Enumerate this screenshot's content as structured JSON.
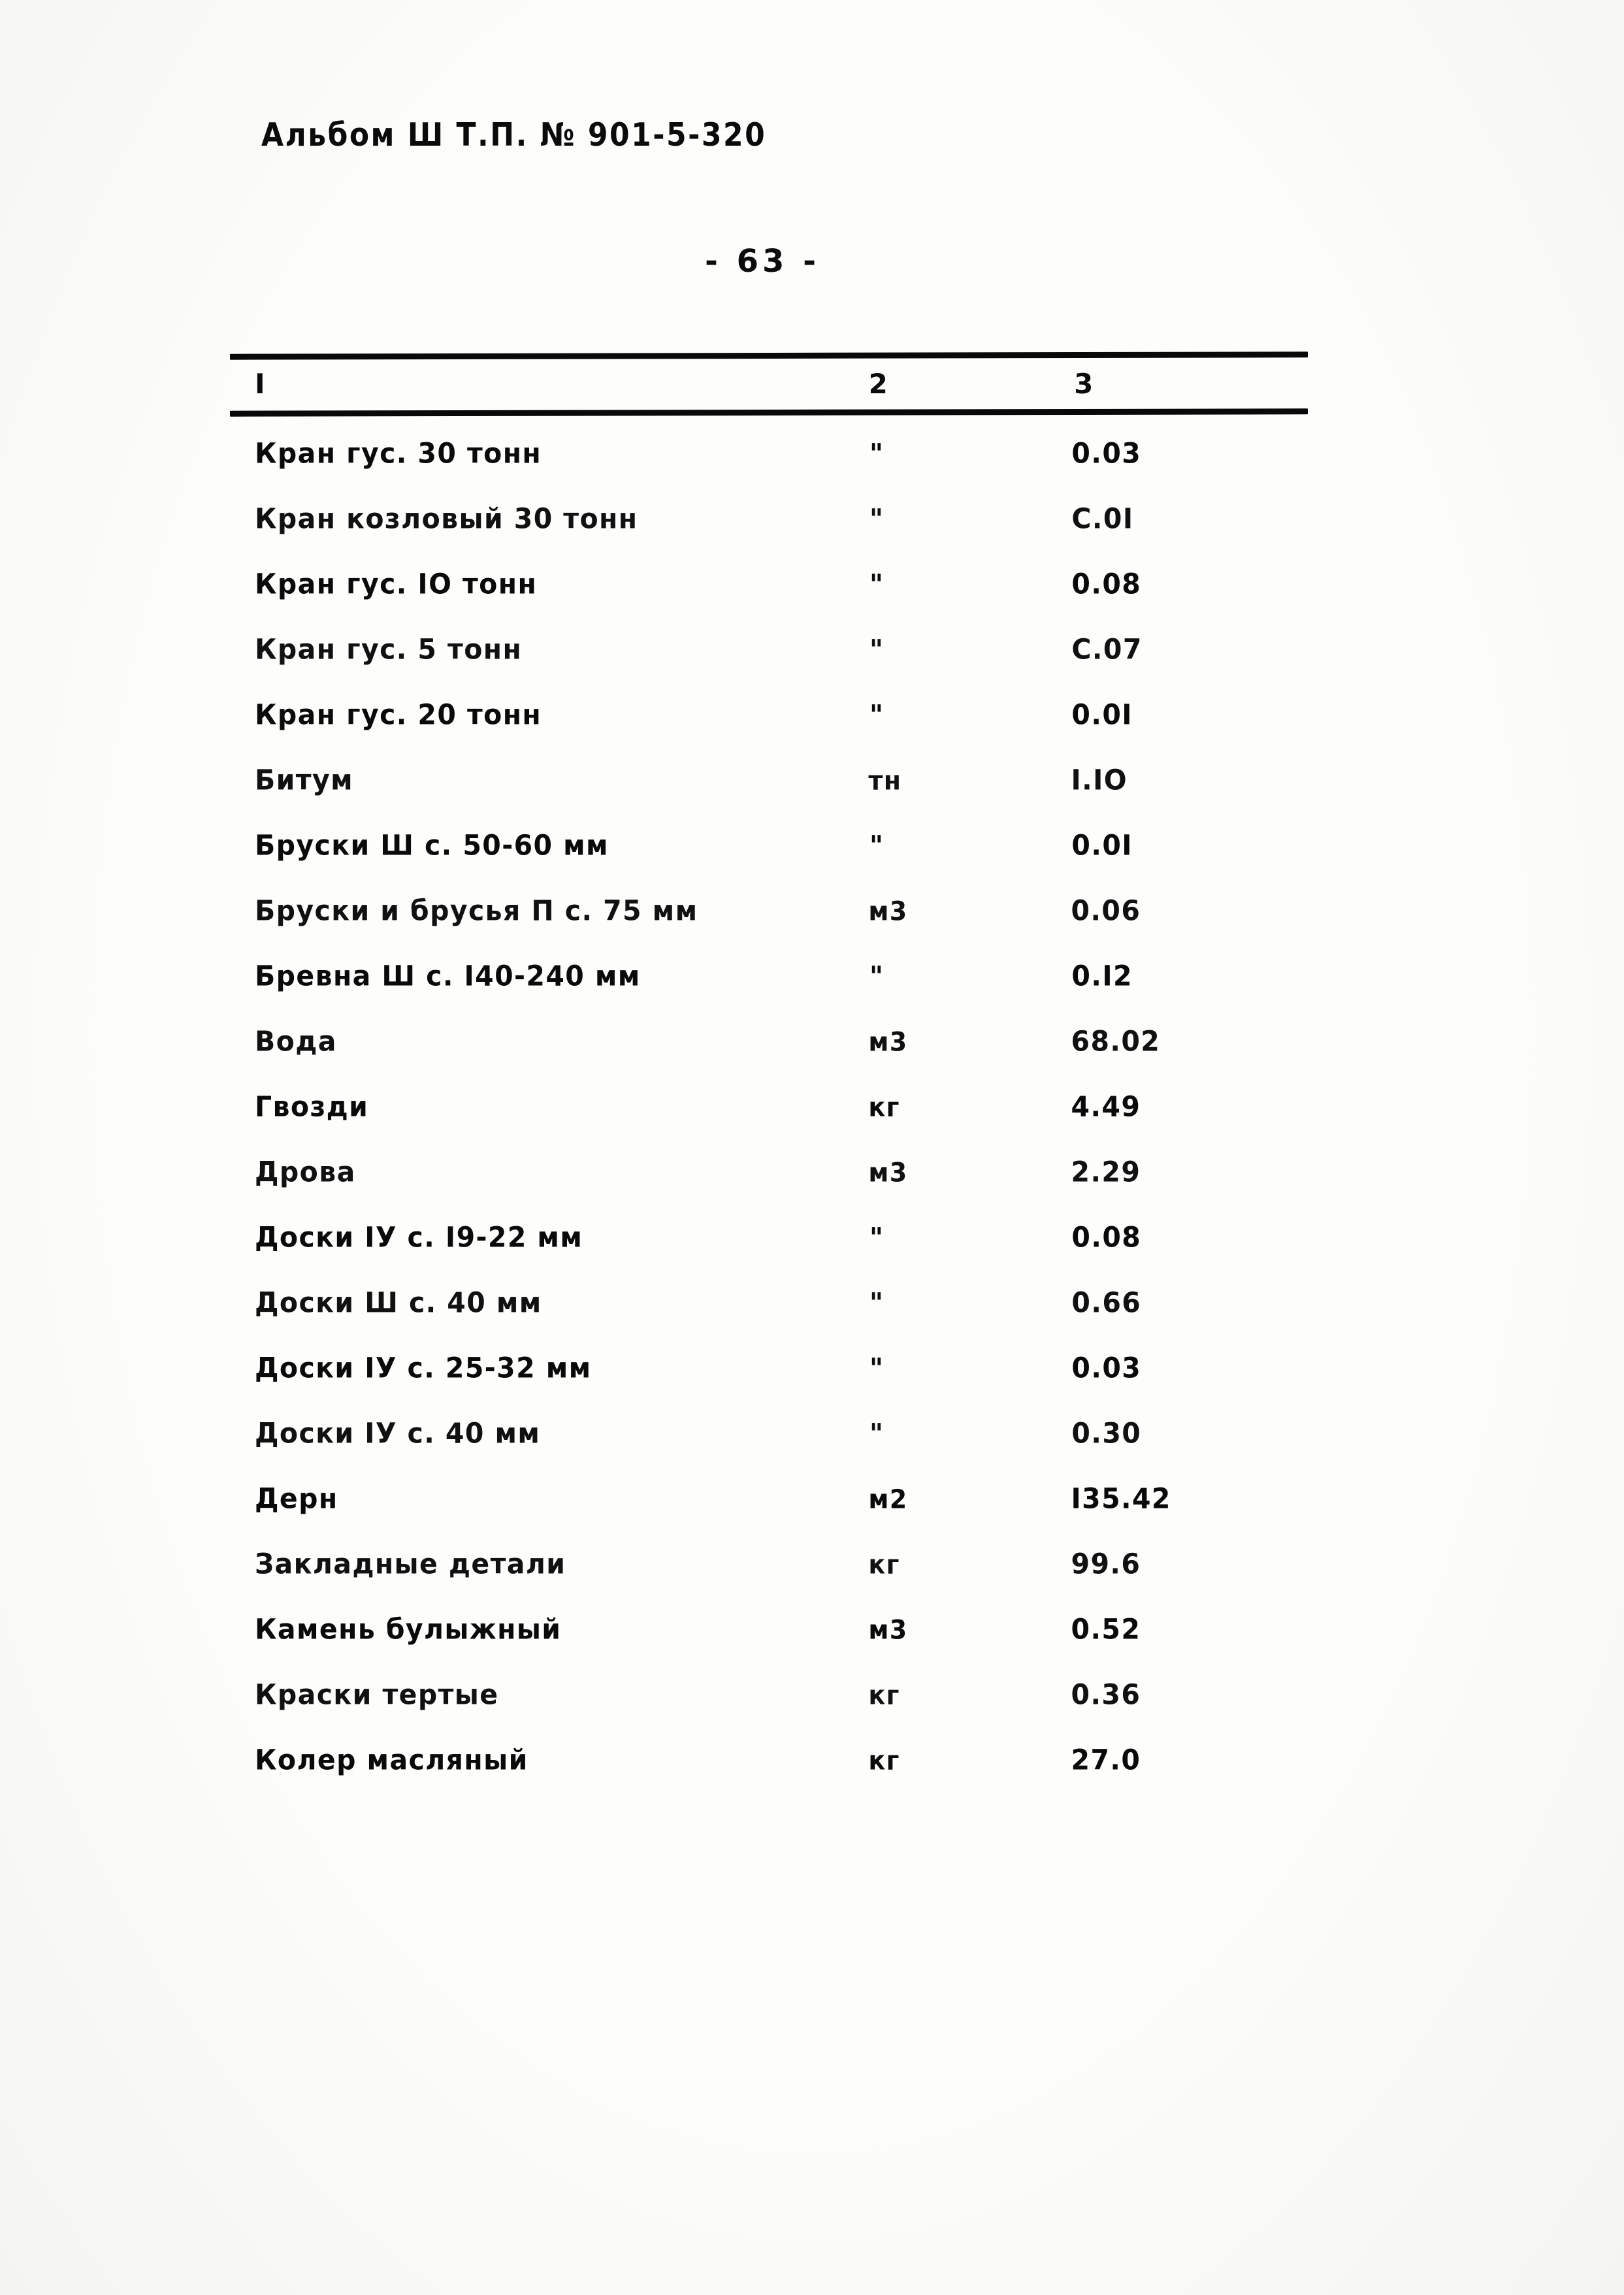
{
  "document": {
    "album_header": "Альбом Ш Т.П. № 901-5-320",
    "page_number": "- 63 -"
  },
  "table": {
    "headers": {
      "col1": "I",
      "col2": "2",
      "col3": "3"
    },
    "rows": [
      {
        "name": "Кран гус. 30 тонн",
        "unit": "\"",
        "value": "0.03"
      },
      {
        "name": "Кран козловый 30 тонн",
        "unit": "\"",
        "value": "С.0I"
      },
      {
        "name": "Кран гус. IO тонн",
        "unit": "\"",
        "value": "0.08"
      },
      {
        "name": "Кран гус. 5 тонн",
        "unit": "\"",
        "value": "С.07"
      },
      {
        "name": "Кран гус. 20 тонн",
        "unit": "\"",
        "value": "0.0I"
      },
      {
        "name": "Битум",
        "unit": "тн",
        "value": "I.IO"
      },
      {
        "name": "Бруски Ш с. 50-60 мм",
        "unit": "\"",
        "value": "0.0I"
      },
      {
        "name": "Бруски и брусья П с. 75 мм",
        "unit": "м3",
        "value": "0.06"
      },
      {
        "name": "Бревна Ш с. I40-240 мм",
        "unit": "\"",
        "value": "0.I2"
      },
      {
        "name": "Вода",
        "unit": "м3",
        "value": "68.02"
      },
      {
        "name": "Гвозди",
        "unit": "кг",
        "value": "4.49"
      },
      {
        "name": "Дрова",
        "unit": "м3",
        "value": "2.29"
      },
      {
        "name": "Доски IУ с. I9-22 мм",
        "unit": "\"",
        "value": "0.08"
      },
      {
        "name": "Доски Ш с. 40 мм",
        "unit": "\"",
        "value": "0.66"
      },
      {
        "name": "Доски IУ с. 25-32  мм",
        "unit": "\"",
        "value": "0.03"
      },
      {
        "name": "Доски IУ с. 40 мм",
        "unit": "\"",
        "value": "0.30"
      },
      {
        "name": "Дерн",
        "unit": "м2",
        "value": "I35.42"
      },
      {
        "name": "Закладные детали",
        "unit": "кг",
        "value": "99.6"
      },
      {
        "name": "Камень булыжный",
        "unit": "м3",
        "value": "0.52"
      },
      {
        "name": "Краски тертые",
        "unit": "кг",
        "value": "0.36"
      },
      {
        "name": "Колер масляный",
        "unit": "кг",
        "value": "27.0"
      }
    ]
  }
}
